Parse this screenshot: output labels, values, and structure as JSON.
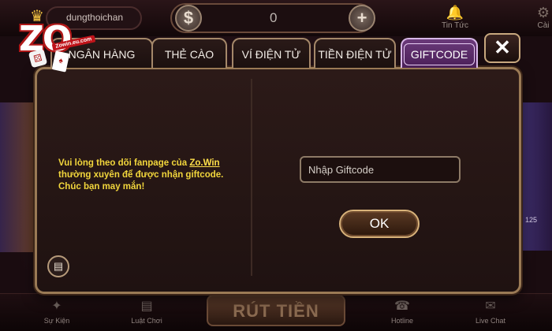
{
  "logo": {
    "brand_tag": "Zowin.eu.com",
    "letters": "ZO",
    "crown": "crown-icon"
  },
  "topbar": {
    "username": "dungthoichan",
    "balance_currency": "$",
    "balance": "0",
    "add_symbol": "+",
    "news_label": "Tin Tức",
    "settings_label": "Cài"
  },
  "tabs": [
    {
      "label": "NGÂN HÀNG"
    },
    {
      "label": "THẺ CÀO"
    },
    {
      "label": "VÍ ĐIỆN TỬ"
    },
    {
      "label": "TIỀN ĐIỆN TỬ"
    },
    {
      "label": "GIFTCODE",
      "active": true
    }
  ],
  "modal": {
    "close": "✕",
    "info_prefix": "Vui lòng theo dõi fanpage của ",
    "info_link": "Zo.Win",
    "info_line2": "thường xuyên để được nhận giftcode.",
    "info_line3": "Chúc bạn may mắn!",
    "input_placeholder": "Nhập Giftcode",
    "ok_label": "OK"
  },
  "side": {
    "right_badge": "125"
  },
  "bottombar": {
    "items": [
      {
        "label": "Sự Kiện",
        "icon": "star-icon"
      },
      {
        "label": "Luật Chơi",
        "icon": "rules-icon"
      },
      {
        "label": "Hotline",
        "icon": "phone-icon"
      },
      {
        "label": "Live Chat",
        "icon": "chat-icon"
      }
    ],
    "withdraw_label": "RÚT TIỀN"
  },
  "colors": {
    "accent_gold": "#9a7a55",
    "active_tab": "#6b3a7a",
    "info_text": "#f2d63c"
  }
}
